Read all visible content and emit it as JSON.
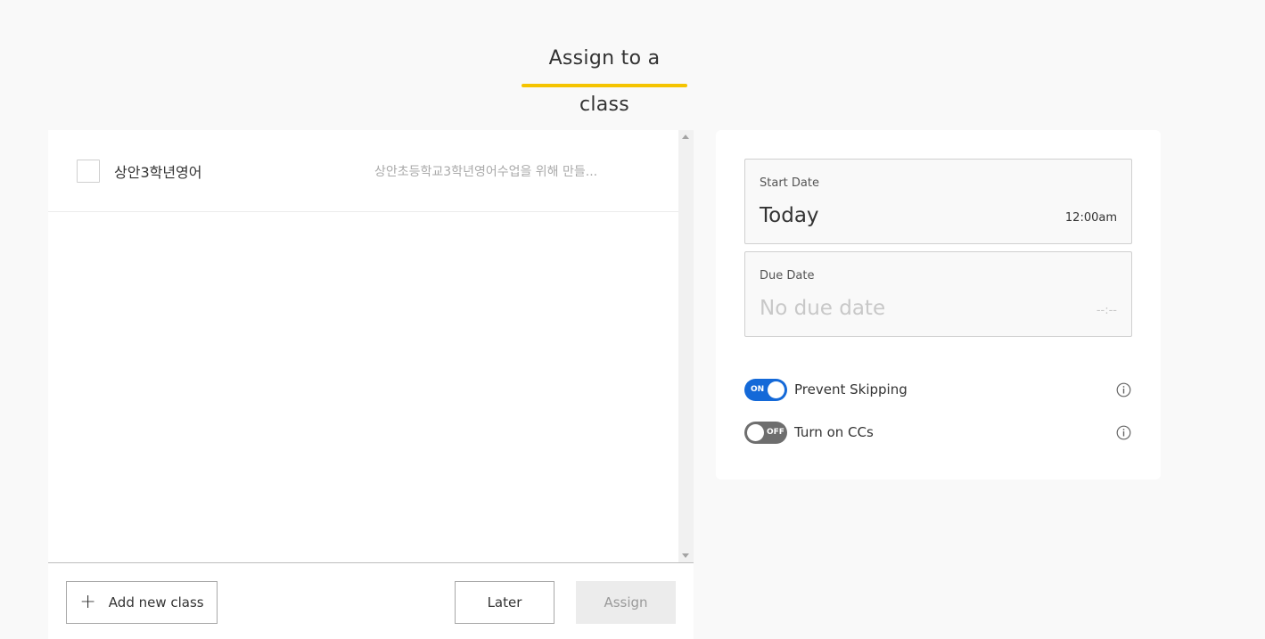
{
  "header": {
    "title": "Assign to a class",
    "accent_color": "#f5c400"
  },
  "classes": {
    "items": [
      {
        "name": "상안3학년영어",
        "description": "상안초등학교3학년영어수업을 위해 만들...",
        "checked": false
      }
    ]
  },
  "footer": {
    "add_icon": "plus-icon",
    "add_label": "Add new class",
    "later_label": "Later",
    "assign_label": "Assign"
  },
  "settings": {
    "start": {
      "label": "Start Date",
      "value": "Today",
      "time": "12:00am"
    },
    "due": {
      "label": "Due Date",
      "placeholder": "No due date",
      "time_placeholder": "--:--"
    },
    "toggles": [
      {
        "label": "Prevent Skipping",
        "state": "ON",
        "on": true,
        "color": "#1469d8",
        "icon": "info-icon"
      },
      {
        "label": "Turn on CCs",
        "state": "OFF",
        "on": false,
        "color": "#6e6e6e",
        "icon": "info-icon"
      }
    ]
  }
}
